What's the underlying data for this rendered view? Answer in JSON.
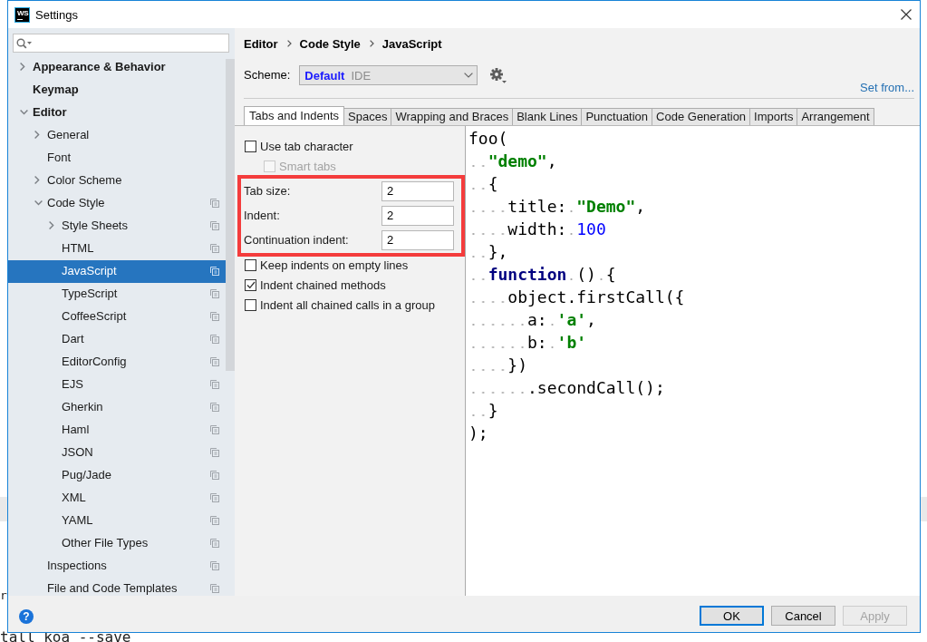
{
  "background_terminal": {
    "lines": [
      "r",
      "tall koa --save"
    ]
  },
  "window": {
    "app_icon_label": "WS",
    "title": "Settings"
  },
  "sidebar": {
    "tree": [
      {
        "label": "Appearance & Behavior",
        "kind": "folder",
        "expanded": false,
        "selected": false,
        "per_project": false
      },
      {
        "label": "Keymap",
        "kind": "leaf",
        "selected": false,
        "per_project": false
      },
      {
        "label": "Editor",
        "kind": "folder",
        "expanded": true,
        "selected": false,
        "per_project": false,
        "children": [
          {
            "label": "General",
            "kind": "folder",
            "expanded": false,
            "selected": false,
            "per_project": false
          },
          {
            "label": "Font",
            "kind": "leaf",
            "selected": false,
            "per_project": false
          },
          {
            "label": "Color Scheme",
            "kind": "folder",
            "expanded": false,
            "selected": false,
            "per_project": false
          },
          {
            "label": "Code Style",
            "kind": "folder",
            "expanded": true,
            "selected": false,
            "per_project": true,
            "children": [
              {
                "label": "Style Sheets",
                "kind": "folder",
                "expanded": false,
                "selected": false,
                "per_project": true
              },
              {
                "label": "HTML",
                "kind": "leaf",
                "selected": false,
                "per_project": true
              },
              {
                "label": "JavaScript",
                "kind": "leaf",
                "selected": true,
                "per_project": true
              },
              {
                "label": "TypeScript",
                "kind": "leaf",
                "selected": false,
                "per_project": true
              },
              {
                "label": "CoffeeScript",
                "kind": "leaf",
                "selected": false,
                "per_project": true
              },
              {
                "label": "Dart",
                "kind": "leaf",
                "selected": false,
                "per_project": true
              },
              {
                "label": "EditorConfig",
                "kind": "leaf",
                "selected": false,
                "per_project": true
              },
              {
                "label": "EJS",
                "kind": "leaf",
                "selected": false,
                "per_project": true
              },
              {
                "label": "Gherkin",
                "kind": "leaf",
                "selected": false,
                "per_project": true
              },
              {
                "label": "Haml",
                "kind": "leaf",
                "selected": false,
                "per_project": true
              },
              {
                "label": "JSON",
                "kind": "leaf",
                "selected": false,
                "per_project": true
              },
              {
                "label": "Pug/Jade",
                "kind": "leaf",
                "selected": false,
                "per_project": true
              },
              {
                "label": "XML",
                "kind": "leaf",
                "selected": false,
                "per_project": true
              },
              {
                "label": "YAML",
                "kind": "leaf",
                "selected": false,
                "per_project": true
              },
              {
                "label": "Other File Types",
                "kind": "leaf",
                "selected": false,
                "per_project": true
              }
            ]
          },
          {
            "label": "Inspections",
            "kind": "leaf",
            "selected": false,
            "per_project": true
          },
          {
            "label": "File and Code Templates",
            "kind": "leaf",
            "selected": false,
            "per_project": true
          }
        ]
      }
    ]
  },
  "breadcrumb": [
    "Editor",
    "Code Style",
    "JavaScript"
  ],
  "scheme": {
    "label": "Scheme:",
    "name": "Default",
    "scope": "IDE"
  },
  "set_from_link": "Set from...",
  "tabs": [
    {
      "label": "Tabs and Indents",
      "selected": true
    },
    {
      "label": "Spaces",
      "selected": false
    },
    {
      "label": "Wrapping and Braces",
      "selected": false
    },
    {
      "label": "Blank Lines",
      "selected": false
    },
    {
      "label": "Punctuation",
      "selected": false
    },
    {
      "label": "Code Generation",
      "selected": false
    },
    {
      "label": "Imports",
      "selected": false
    },
    {
      "label": "Arrangement",
      "selected": false
    }
  ],
  "options": [
    {
      "kind": "checkbox",
      "label": "Use tab character",
      "checked": false,
      "disabled": false,
      "children": [
        {
          "kind": "checkbox",
          "label": "Smart tabs",
          "checked": false,
          "disabled": true
        }
      ]
    },
    {
      "kind": "highlight",
      "fields": [
        {
          "label": "Tab size:",
          "value": "2"
        },
        {
          "label": "Indent:",
          "value": "2"
        },
        {
          "label": "Continuation indent:",
          "value": "2"
        }
      ]
    },
    {
      "kind": "checkbox",
      "label": "Keep indents on empty lines",
      "checked": false,
      "disabled": false
    },
    {
      "kind": "checkbox",
      "label": "Indent chained methods",
      "checked": true,
      "disabled": false
    },
    {
      "kind": "checkbox",
      "label": "Indent all chained calls in a group",
      "checked": false,
      "disabled": false
    }
  ],
  "code_preview": {
    "lines": [
      {
        "tokens": [
          {
            "kind": "plain",
            "text": "foo("
          }
        ]
      },
      {
        "tokens": [
          {
            "kind": "string",
            "text": "  \"demo\""
          },
          {
            "kind": "plain",
            "text": ","
          }
        ]
      },
      {
        "tokens": [
          {
            "kind": "plain",
            "text": "  {"
          }
        ]
      },
      {
        "tokens": [
          {
            "kind": "plain",
            "text": "    title: "
          },
          {
            "kind": "string",
            "text": "\"Demo\""
          },
          {
            "kind": "plain",
            "text": ","
          }
        ]
      },
      {
        "tokens": [
          {
            "kind": "plain",
            "text": "    width: "
          },
          {
            "kind": "number",
            "text": "100"
          }
        ]
      },
      {
        "tokens": [
          {
            "kind": "plain",
            "text": "  },"
          }
        ]
      },
      {
        "tokens": [
          {
            "kind": "keyword",
            "text": "  function"
          },
          {
            "kind": "plain",
            "text": " () {"
          }
        ]
      },
      {
        "tokens": [
          {
            "kind": "plain",
            "text": "    object.firstCall({"
          }
        ]
      },
      {
        "tokens": [
          {
            "kind": "plain",
            "text": "      a: "
          },
          {
            "kind": "string",
            "text": "'a'"
          },
          {
            "kind": "plain",
            "text": ","
          }
        ]
      },
      {
        "tokens": [
          {
            "kind": "plain",
            "text": "      b: "
          },
          {
            "kind": "string",
            "text": "'b'"
          }
        ]
      },
      {
        "tokens": [
          {
            "kind": "plain",
            "text": "    })"
          }
        ]
      },
      {
        "tokens": [
          {
            "kind": "plain",
            "text": "      .secondCall();"
          }
        ]
      },
      {
        "tokens": [
          {
            "kind": "plain",
            "text": "  }"
          }
        ]
      },
      {
        "tokens": [
          {
            "kind": "plain",
            "text": ");"
          }
        ]
      }
    ]
  },
  "help_button": {
    "label": "?"
  },
  "buttons": [
    {
      "label": "OK",
      "focused": true,
      "disabled": false
    },
    {
      "label": "Cancel",
      "focused": false,
      "disabled": false
    },
    {
      "label": "Apply",
      "focused": false,
      "disabled": true
    }
  ]
}
